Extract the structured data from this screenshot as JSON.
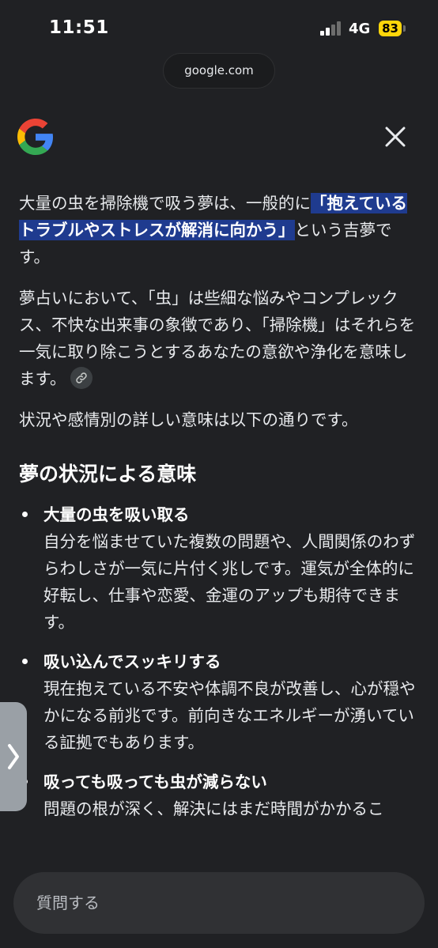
{
  "status_bar": {
    "time": "11:51",
    "network": "4G",
    "battery": "83"
  },
  "browser": {
    "url": "google.com"
  },
  "header": {
    "logo_icon": "google-g-icon",
    "close_icon": "close-icon"
  },
  "answer": {
    "intro_before": "大量の虫を掃除機で吸う夢は、一般的に",
    "intro_highlight": "「抱えているトラブルやストレスが解消に向かう」",
    "intro_after": "という吉夢です。",
    "paragraph2": "夢占いにおいて、「虫」は些細な悩みやコンプレックス、不快な出来事の象徴であり、「掃除機」はそれらを一気に取り除こうとするあなたの意欲や浄化を意味します。",
    "paragraph3": "状況や感情別の詳しい意味は以下の通りです。",
    "section_title": "夢の状況による意味",
    "items": [
      {
        "title": "大量の虫を吸い取る",
        "body": "自分を悩ませていた複数の問題や、人間関係のわずらわしさが一気に片付く兆しです。運気が全体的に好転し、仕事や恋愛、金運のアップも期待できます。"
      },
      {
        "title": "吸い込んでスッキリする",
        "body": "現在抱えている不安や体調不良が改善し、心が穏やかになる前兆です。前向きなエネルギーが湧いている証拠でもあります。"
      },
      {
        "title": "吸っても吸っても虫が減らない",
        "body": "問題の根が深く、解決にはまだ時間がかかるこ"
      }
    ]
  },
  "ask_bar": {
    "placeholder": "質問する"
  },
  "colors": {
    "background": "#202124",
    "highlight": "#1f3b8f",
    "battery": "#ffd60a"
  }
}
